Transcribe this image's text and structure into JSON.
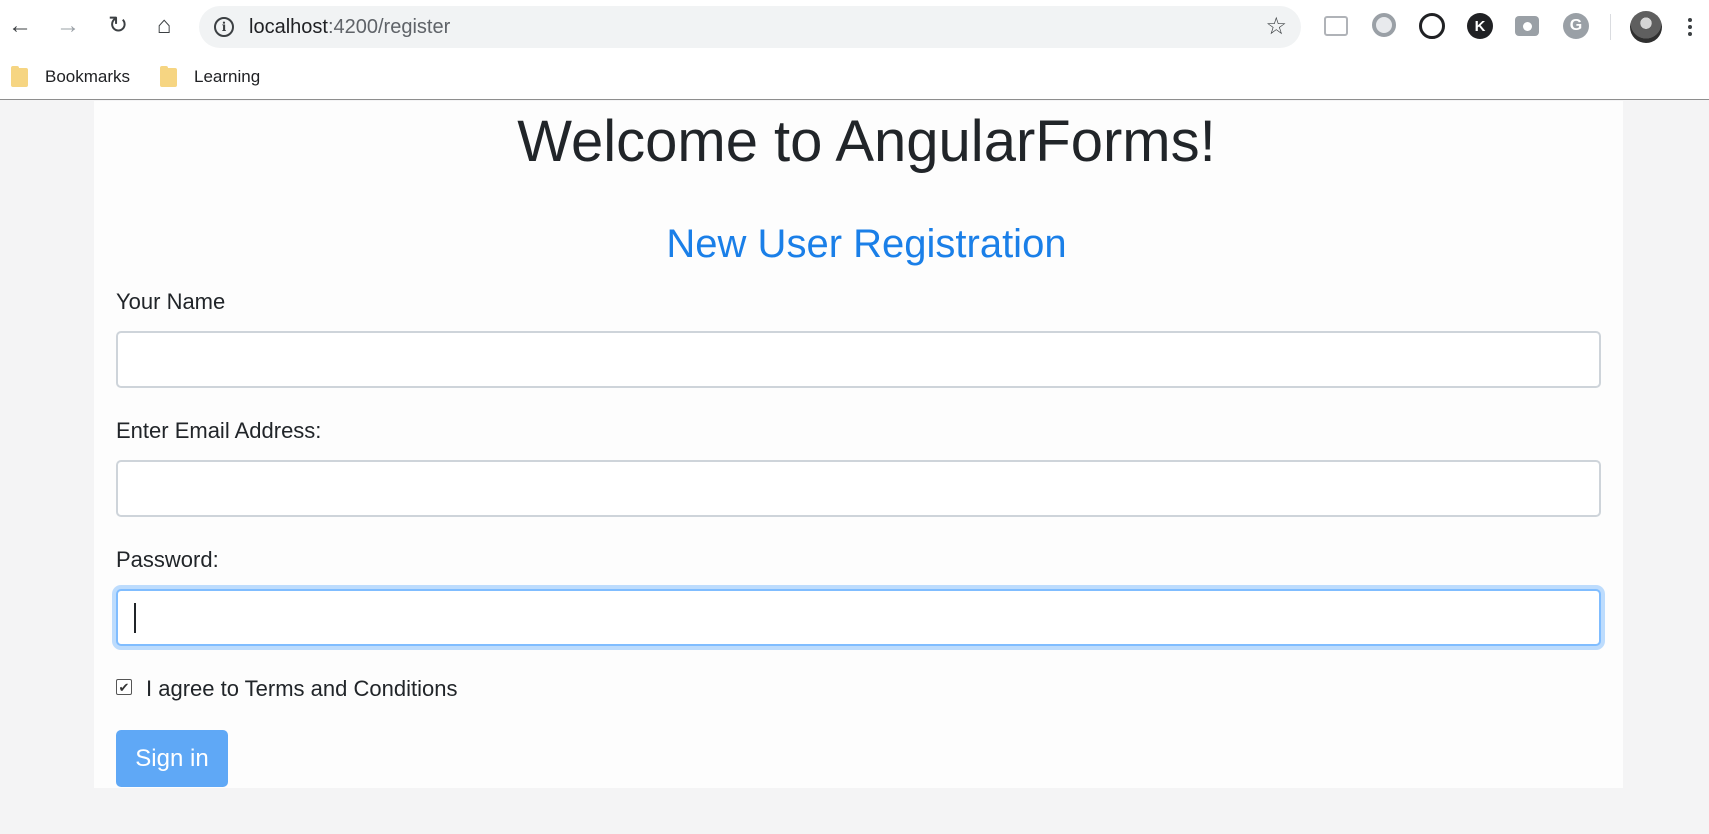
{
  "browser": {
    "url_host": "localhost",
    "url_rest": ":4200/register",
    "bookmarks": [
      {
        "label": "Bookmarks"
      },
      {
        "label": "Learning"
      }
    ],
    "extensions": [
      "video-extension-icon",
      "circle-extension-icon",
      "openai-extension-icon",
      "k-extension-icon",
      "camera-extension-icon",
      "grammarly-extension-icon"
    ],
    "ext_letters": {
      "k": "K",
      "g": "G"
    }
  },
  "page": {
    "title": "Welcome to AngularForms!",
    "form_heading": "New User Registration",
    "heading_color": "#1a7fe8"
  },
  "form": {
    "name_label": "Your Name",
    "name_value": "",
    "email_label": "Enter Email Address:",
    "email_value": "",
    "password_label": "Password:",
    "password_value": "",
    "password_focused": true,
    "terms_label": "I agree to Terms and Conditions",
    "terms_checked": true,
    "checkmark": "✔",
    "submit_label": "Sign in",
    "submit_color": "#5fa8f6"
  }
}
